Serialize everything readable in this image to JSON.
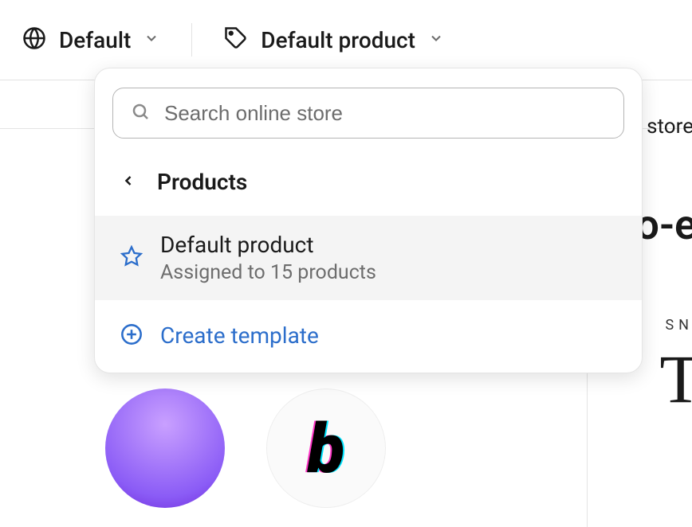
{
  "topbar": {
    "theme_label": "Default",
    "product_label": "Default product"
  },
  "dropdown": {
    "search_placeholder": "Search online store",
    "section_title": "Products",
    "item": {
      "title": "Default product",
      "subtitle": "Assigned to 15 products"
    },
    "create_label": "Create template"
  },
  "background": {
    "text_store": "store",
    "text_co": "co-e",
    "text_sn": "SN",
    "text_t": "T"
  }
}
